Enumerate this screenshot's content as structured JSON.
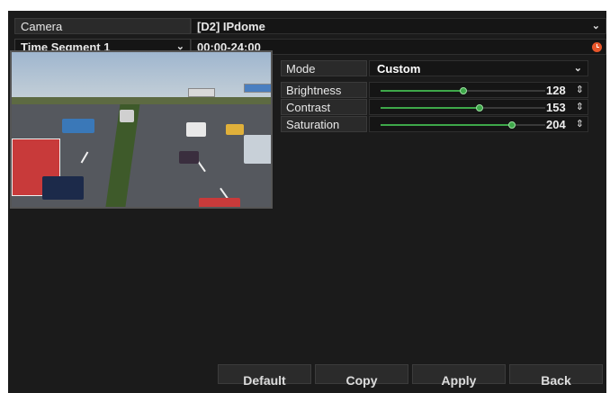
{
  "camera": {
    "label": "Camera",
    "value": "[D2] IPdome"
  },
  "time_segment": {
    "label": "Time Segment 1",
    "value": "00:00-24:00"
  },
  "mode": {
    "label": "Mode",
    "value": "Custom"
  },
  "sliders": [
    {
      "label": "Brightness",
      "value": "128",
      "fraction": 0.502
    },
    {
      "label": "Contrast",
      "value": "153",
      "fraction": 0.6
    },
    {
      "label": "Saturation",
      "value": "204",
      "fraction": 0.8
    }
  ],
  "buttons": {
    "default": "Default",
    "copy": "Copy",
    "apply": "Apply",
    "back": "Back"
  },
  "icons": {
    "dropdown": "chevron-down-icon",
    "clock": "clock-icon",
    "spinner": "spinner-arrows-icon"
  },
  "colors": {
    "accent": "#3ea84a",
    "clock": "#e8552a",
    "panel": "#1b1b1b"
  }
}
